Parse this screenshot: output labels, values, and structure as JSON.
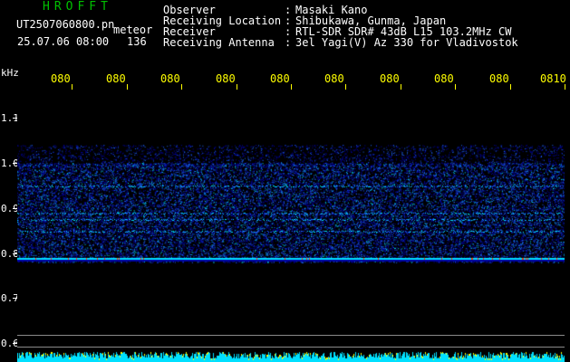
{
  "header": {
    "title": "HROFFT",
    "filename": "UT2507060800.pn",
    "meteor_label": "meteor",
    "datetime": "25.07.06 08:00",
    "count": "136"
  },
  "info": [
    {
      "label": "Observer",
      "value": "Masaki Kano"
    },
    {
      "label": "Receiving Location",
      "value": "Shibukawa, Gunma, Japan"
    },
    {
      "label": "Receiver",
      "value": "RTL-SDR SDR# 43dB L15 103.2MHz CW"
    },
    {
      "label": "Receiving Antenna",
      "value": "3el Yagi(V) Az 330 for Vladivostok"
    }
  ],
  "colon": ":",
  "axis": {
    "y_unit": "kHz",
    "y_ticks": [
      "1.1",
      "1.0",
      "0.9",
      "0.8",
      "0.7",
      "0.6"
    ],
    "x_ticks": [
      "080",
      "080",
      "080",
      "080",
      "080",
      "080",
      "080",
      "080",
      "080",
      "0810"
    ]
  },
  "spectrogram": {
    "freq_range_khz": [
      0.58,
      1.12
    ],
    "signal_band_khz": [
      0.78,
      1.0
    ],
    "carrier_khz": 0.79,
    "meteor_echo_lines_khz": [
      0.95,
      0.89,
      0.876,
      0.85
    ],
    "colors": {
      "background": "#000000",
      "low": "#0000a0",
      "mid": "#1e64ff",
      "high": "#00e0ff",
      "peak": "#ff4000"
    }
  }
}
